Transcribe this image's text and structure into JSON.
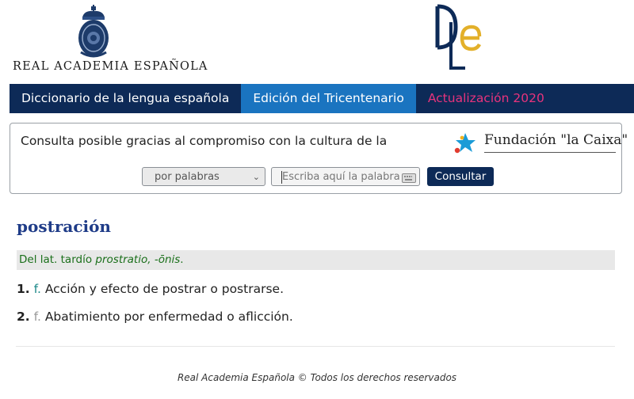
{
  "header": {
    "rae_logo": {
      "text": "REAL ACADEMIA ESPAÑOLA",
      "icon": "crest-icon"
    },
    "dle_logo": {
      "text": "DLE"
    }
  },
  "nav": {
    "tabs": [
      {
        "label": "Diccionario de la lengua española"
      },
      {
        "label": "Edición del Tricentenario"
      },
      {
        "label": "Actualización 2020"
      }
    ]
  },
  "search": {
    "sponsor_text": "Consulta posible gracias al compromiso con la cultura de la",
    "sponsor_logo": {
      "text": "Fundación \"la Caixa\"",
      "icon": "caixa-star-icon"
    },
    "mode_select": {
      "selected": "por palabras",
      "icon": "chevron-down-icon"
    },
    "input": {
      "placeholder": "Escriba aquí la palabra",
      "icon": "keyboard-icon"
    },
    "button_label": "Consultar"
  },
  "entry": {
    "headword": "postración",
    "etymology": {
      "prefix": "Del lat. tardío",
      "form": "prostratio, -ōnis",
      "suffix": "."
    },
    "senses": [
      {
        "number": "1.",
        "category": "f.",
        "definition": "Acción y efecto de postrar o postrarse."
      },
      {
        "number": "2.",
        "category": "f.",
        "definition": "Abatimiento por enfermedad o aflicción."
      }
    ]
  },
  "footer": {
    "text": "Real Academia Española © Todos los derechos reservados"
  },
  "colors": {
    "nav_bg": "#0d2a57",
    "nav_active": "#1a74c0",
    "update_pink": "#e8337c",
    "headword": "#1f3c88",
    "etymology": "#1a6f1a"
  }
}
